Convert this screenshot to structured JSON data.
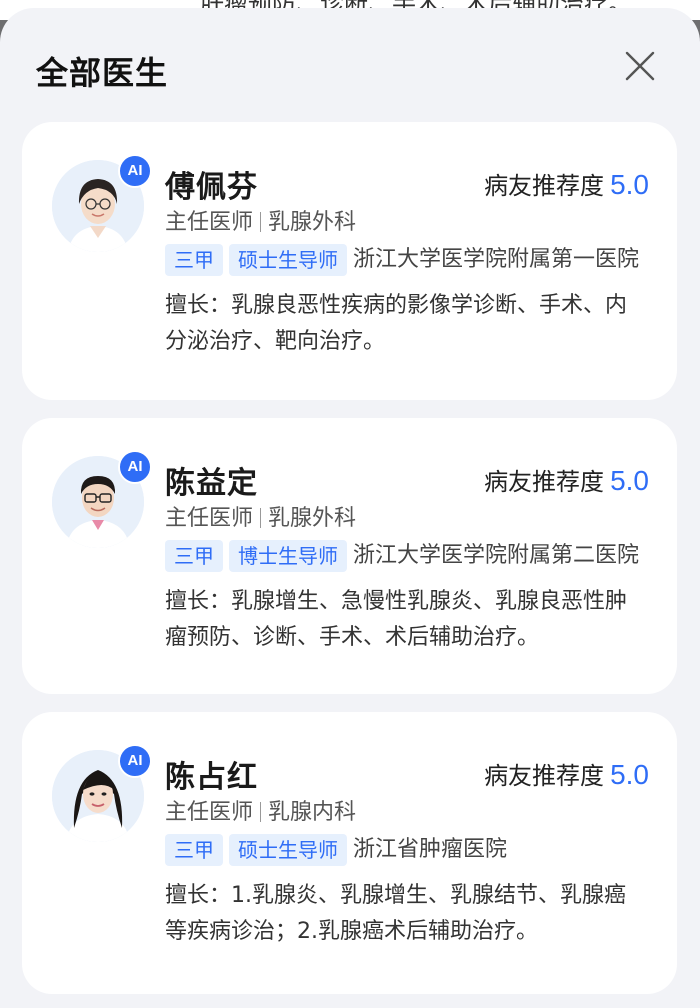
{
  "background_snippet": "肝瘤预防、诊断、手术、术后辅助治疗。",
  "sheet": {
    "title": "全部医生",
    "close_icon": "close-icon"
  },
  "colors": {
    "accent": "#2f6df6",
    "tag_bg": "#e6f0fd",
    "sheet_bg": "#f2f3f7",
    "card_bg": "#ffffff"
  },
  "rating_label": "病友推荐度",
  "specialty_label": "擅长：",
  "ai_badge": "AI",
  "doctors": [
    {
      "name": "傅佩芬",
      "title": "主任医师",
      "department": "乳腺外科",
      "rating": "5.0",
      "tags": [
        "三甲",
        "硕士生导师"
      ],
      "hospital": "浙江大学医学院附属第一医院",
      "specialty": "乳腺良恶性疾病的影像学诊断、手术、内分泌治疗、靶向治疗。"
    },
    {
      "name": "陈益定",
      "title": "主任医师",
      "department": "乳腺外科",
      "rating": "5.0",
      "tags": [
        "三甲",
        "博士生导师"
      ],
      "hospital": "浙江大学医学院附属第二医院",
      "specialty": "乳腺增生、急慢性乳腺炎、乳腺良恶性肿瘤预防、诊断、手术、术后辅助治疗。"
    },
    {
      "name": "陈占红",
      "title": "主任医师",
      "department": "乳腺内科",
      "rating": "5.0",
      "tags": [
        "三甲",
        "硕士生导师"
      ],
      "hospital": "浙江省肿瘤医院",
      "specialty": "1.乳腺炎、乳腺增生、乳腺结节、乳腺癌等疾病诊治；2.乳腺癌术后辅助治疗。"
    }
  ]
}
